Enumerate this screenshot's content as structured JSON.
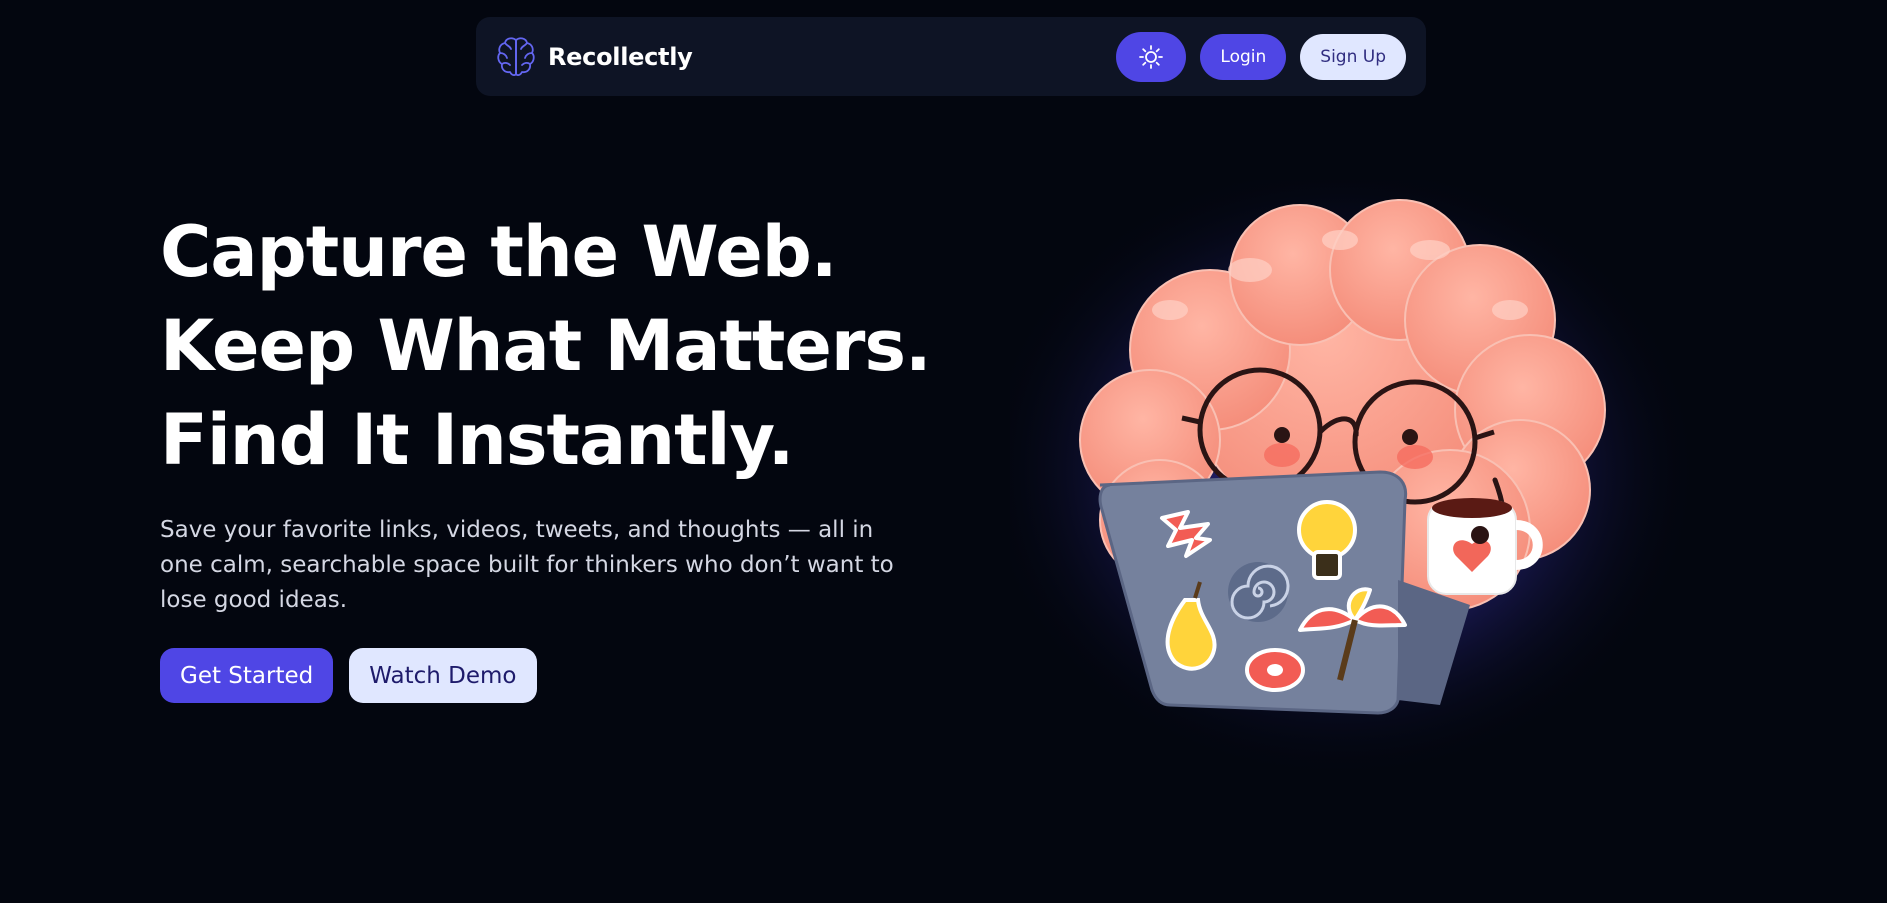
{
  "navbar": {
    "brand_name": "Recollectly",
    "brand_icon": "brain-icon",
    "theme_toggle_icon": "sun-icon",
    "login_label": "Login",
    "signup_label": "Sign Up"
  },
  "hero": {
    "headline_lines": [
      "Capture the Web.",
      "Keep What Matters.",
      "Find It Instantly."
    ],
    "subtext": "Save your favorite links, videos, tweets, and thoughts — all in one calm, searchable space built for thinkers who don’t want to lose good ideas.",
    "primary_cta": "Get Started",
    "secondary_cta": "Watch Demo"
  },
  "illustration": {
    "subject": "brain-mascot-with-laptop-illustration"
  },
  "colors": {
    "background": "#03060f",
    "navbar_bg": "#0e1425",
    "accent": "#4f46e5",
    "accent_light": "#e0e7ff",
    "brain_pink": "#fb9f8c",
    "laptop_gray": "#75819d"
  }
}
